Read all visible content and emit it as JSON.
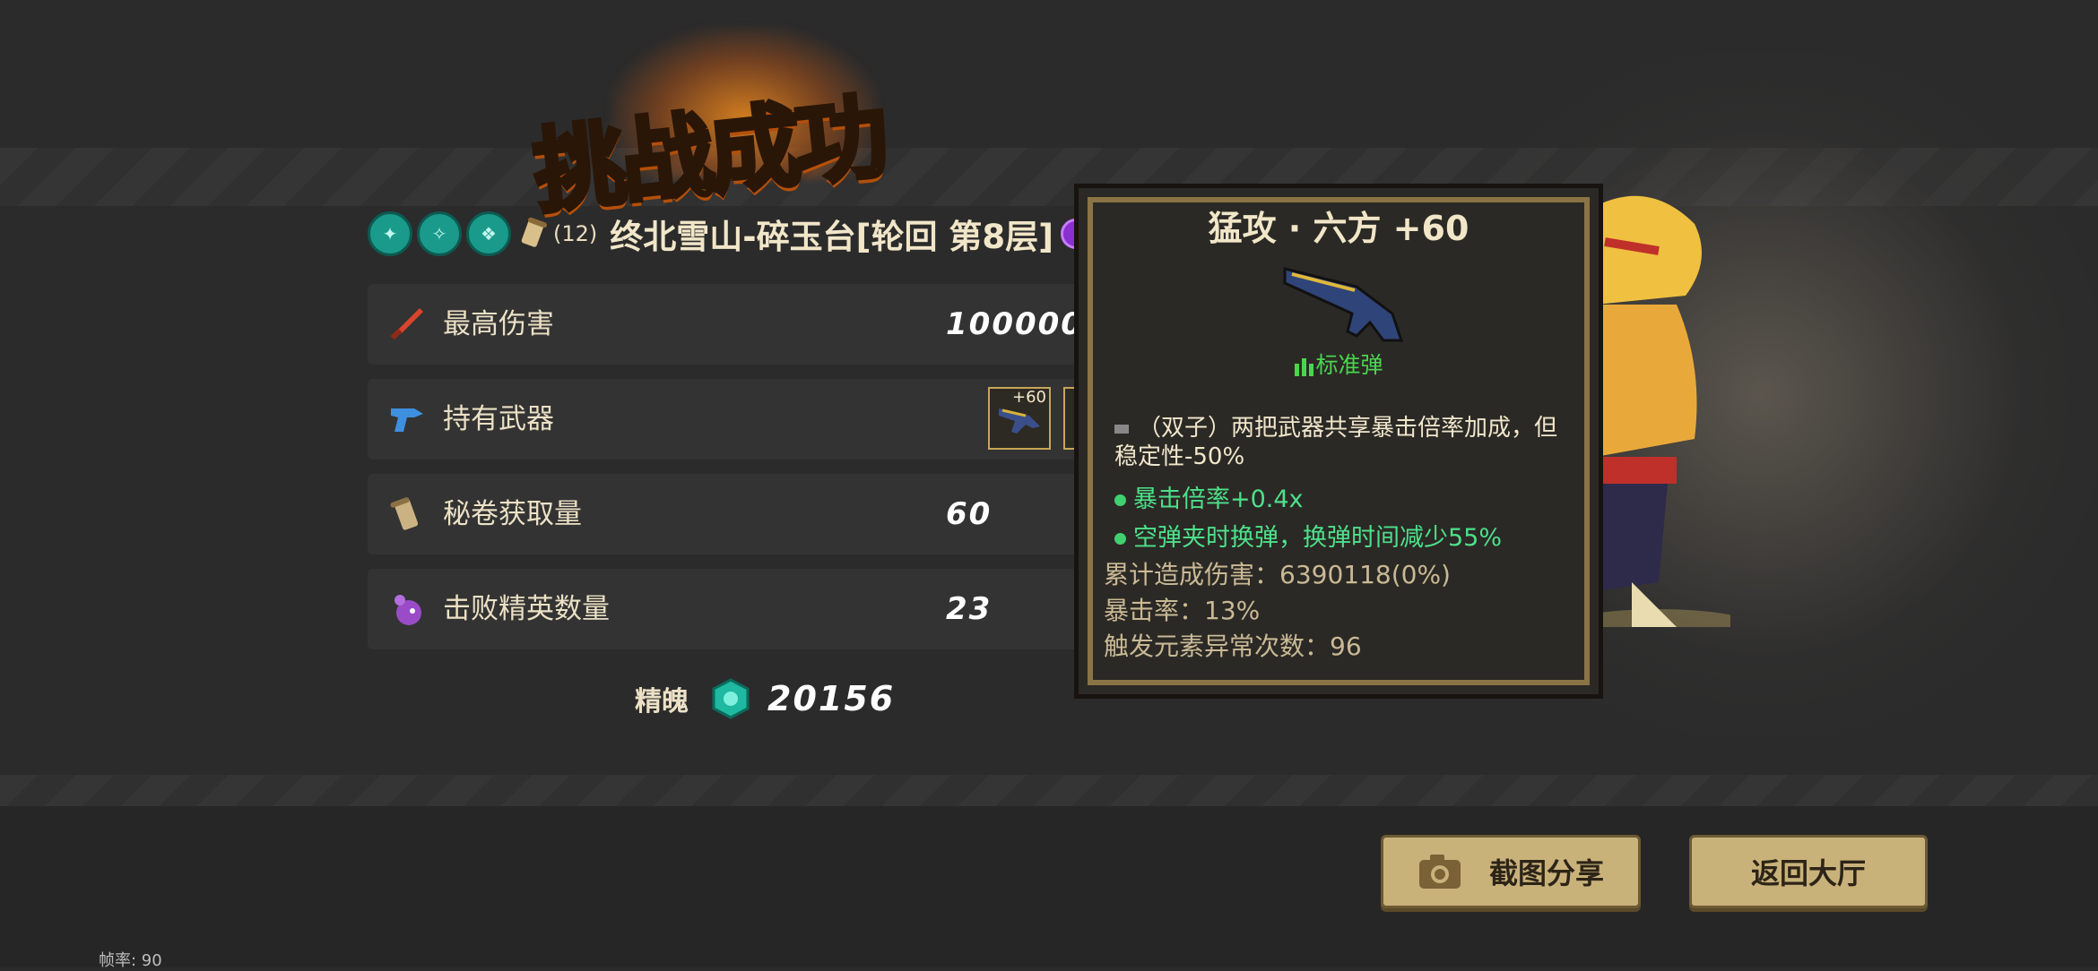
{
  "banner": {
    "title": "挑战成功"
  },
  "stage": {
    "relic_icons": [
      "relic-icon-1",
      "relic-icon-2",
      "relic-icon-3"
    ],
    "scroll_count": "(12)",
    "name": "终北雪山-碎玉台[轮回  第8层]"
  },
  "stats": [
    {
      "icon": "dagger-icon",
      "label": "最高伤害",
      "value": "100000"
    },
    {
      "icon": "pistol-icon",
      "label": "持有武器",
      "value": ""
    },
    {
      "icon": "scroll-icon",
      "label": "秘卷获取量",
      "value": "60"
    },
    {
      "icon": "elite-monster-icon",
      "label": "击败精英数量",
      "value": "23"
    }
  ],
  "weapons": [
    {
      "plus": "+60",
      "icon": "blaster-icon"
    },
    {
      "plus": "",
      "icon": "blaster-icon"
    }
  ],
  "soul": {
    "label": "精魄",
    "value": "20156"
  },
  "tooltip": {
    "title": "猛攻 · 六方 +60",
    "ammo": "标准弹",
    "description": "（双子）两把武器共享暴击倍率加成，但稳定性-50%",
    "perks": [
      "暴击倍率+0.4x",
      "空弹夹时换弹，换弹时间减少55%"
    ],
    "stats": [
      "累计造成伤害：6390118(0%)",
      "暴击率：13%",
      "触发元素异常次数：96"
    ]
  },
  "buttons": {
    "share": "截图分享",
    "lobby": "返回大厅"
  },
  "fps": "帧率: 90",
  "colors": {
    "accent_gold": "#c9b17a",
    "perk_green": "#4de08a",
    "ammo_green": "#49d64f"
  }
}
